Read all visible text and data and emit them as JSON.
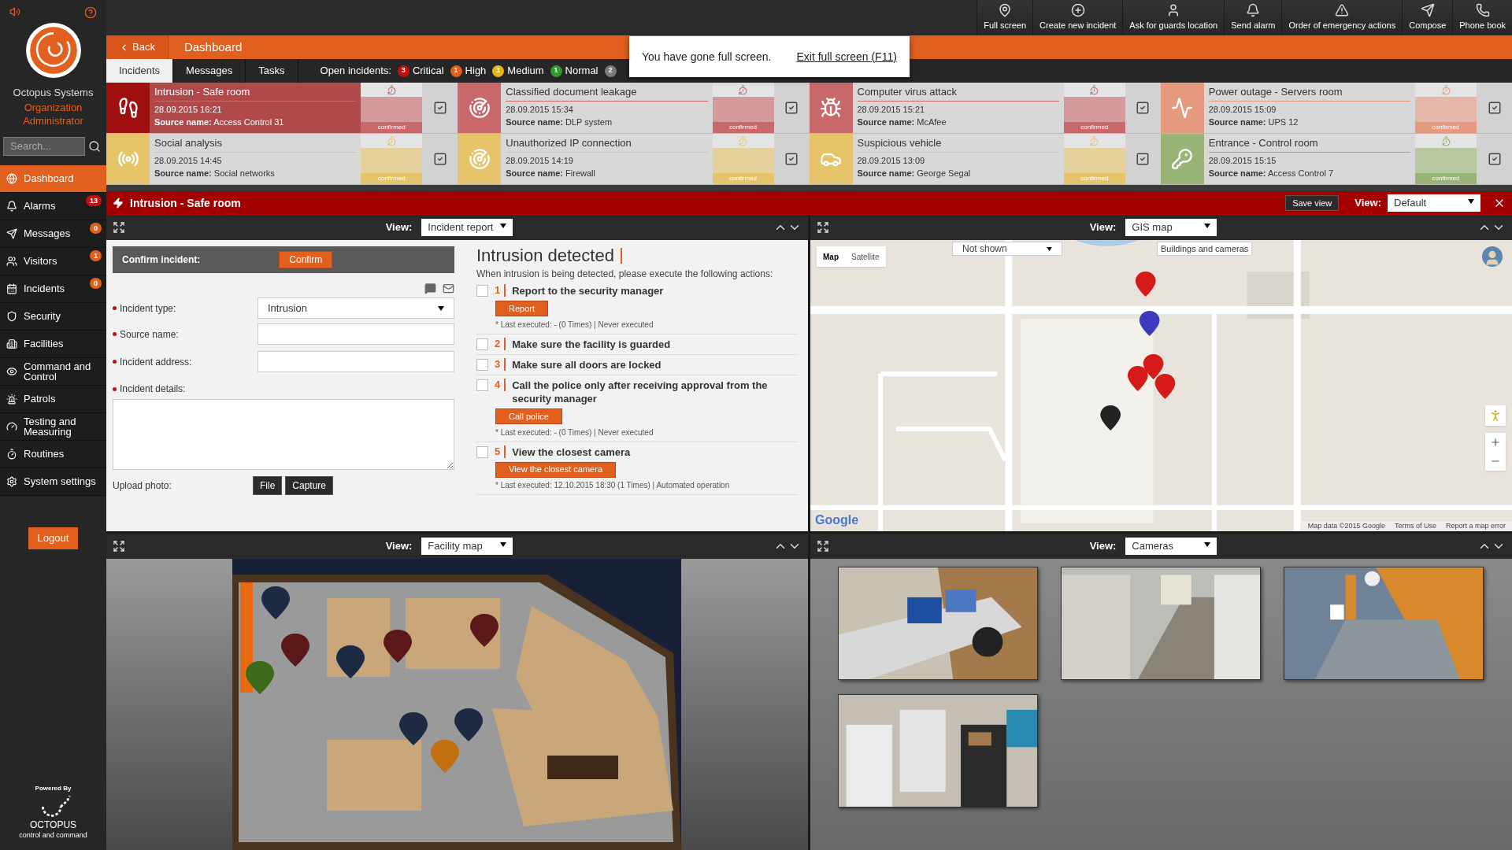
{
  "top_toolbar": [
    {
      "label": "Full screen"
    },
    {
      "label": "Create new incident"
    },
    {
      "label": "Ask for guards location"
    },
    {
      "label": "Send alarm"
    },
    {
      "label": "Order of emergency actions"
    },
    {
      "label": "Compose"
    },
    {
      "label": "Phone book"
    }
  ],
  "sidebar": {
    "org_name": "Octopus Systems",
    "role": "Organization Administrator",
    "search": {
      "placeholder": "Search..."
    },
    "items": [
      {
        "label": "Dashboard",
        "selected": true
      },
      {
        "label": "Alarms",
        "selected": false,
        "badge": "13",
        "color": "#c40f0f"
      },
      {
        "label": "Messages",
        "selected": false,
        "badge": "0",
        "color": "#e2601f"
      },
      {
        "label": "Visitors",
        "selected": false,
        "badge": "1",
        "color": "#e2601f"
      },
      {
        "label": "Incidents",
        "selected": false,
        "badge": "0",
        "color": "#e2601f"
      },
      {
        "label": "Security",
        "selected": false
      },
      {
        "label": "Facilities",
        "selected": false
      },
      {
        "label": "Command and Control",
        "selected": false
      },
      {
        "label": "Patrols",
        "selected": false
      },
      {
        "label": "Testing and Measuring",
        "selected": false
      },
      {
        "label": "Routines",
        "selected": false
      },
      {
        "label": "System settings",
        "selected": false
      }
    ],
    "logout": "Logout",
    "powered_by": "Powered By",
    "brand": "OCTOPUS",
    "brand_tagline": "control and command"
  },
  "header": {
    "back": "Back",
    "title": "Dashboard"
  },
  "tabs": [
    {
      "label": "Incidents",
      "selected": true
    },
    {
      "label": "Messages",
      "selected": false
    },
    {
      "label": "Tasks",
      "selected": false
    }
  ],
  "open_incidents": {
    "label": "Open incidents:",
    "levels": [
      {
        "count": "3",
        "label": "Critical",
        "color": "#c40f0f"
      },
      {
        "count": "1",
        "label": "High",
        "color": "#e2601f"
      },
      {
        "count": "1",
        "label": "Medium",
        "color": "#e8b51c"
      },
      {
        "count": "1",
        "label": "Normal",
        "color": "#2f9a2f"
      },
      {
        "count": "2",
        "color": "#7a7a7a"
      }
    ]
  },
  "fullscreen_notice": {
    "message": "You have gone full screen.",
    "link": "Exit full screen (F11)"
  },
  "incident_cards": [
    {
      "title": "Intrusion - Safe room",
      "date": "28.09.2015 16:21",
      "source_label": "Source name:",
      "source": "Access Control 31",
      "color": "#c8686b",
      "selected": true,
      "status": "confirmed"
    },
    {
      "title": "Classified document leakage",
      "date": "28.09.2015 15:34",
      "source_label": "Source name:",
      "source": "DLP system",
      "color": "#c8686b",
      "selected": false,
      "status": "confirmed"
    },
    {
      "title": "Computer virus attack",
      "date": "28.09.2015 15:21",
      "source_label": "Source name:",
      "source": "McAfee",
      "color": "#c8686b",
      "selected": false,
      "status": "confirmed"
    },
    {
      "title": "Power outage - Servers room",
      "date": "28.09.2015 15:09",
      "source_label": "Source name:",
      "source": "UPS 12",
      "color": "#e59a80",
      "selected": false,
      "status": "confirmed"
    },
    {
      "title": "Social analysis",
      "date": "28.09.2015 14:45",
      "source_label": "Source name:",
      "source": "Social networks",
      "color": "#e6c46a",
      "selected": false,
      "status": "confirmed"
    },
    {
      "title": "Unauthorized IP connection",
      "date": "28.09.2015 14:19",
      "source_label": "Source name:",
      "source": "Firewall",
      "color": "#e6c46a",
      "selected": false,
      "status": "confirmed"
    },
    {
      "title": "Suspicious vehicle",
      "date": "28.09.2015 13:09",
      "source_label": "Source name:",
      "source": "George Segal",
      "color": "#e6c46a",
      "selected": false,
      "status": "confirmed"
    },
    {
      "title": "Entrance - Control room",
      "date": "28.09.2015 15:15",
      "source_label": "Source name:",
      "source": "Access Control 7",
      "color": "#98b476",
      "selected": false,
      "status": "confirmed"
    }
  ],
  "incident_bar": {
    "title": "Intrusion - Safe room",
    "save_view": "Save view",
    "view_label": "View:",
    "view": "Default"
  },
  "report_panel": {
    "view_label": "View:",
    "view": "Incident report",
    "confirm_label": "Confirm incident:",
    "confirm_button": "Confirm",
    "fields": [
      {
        "label": "Incident type:",
        "kind": "select",
        "value": "Intrusion"
      },
      {
        "label": "Source name:",
        "kind": "text"
      },
      {
        "label": "Incident address:",
        "kind": "text"
      },
      {
        "label": "Incident details:",
        "kind": "textarea"
      }
    ],
    "upload_label": "Upload photo:",
    "upload_buttons": [
      "File",
      "Capture"
    ],
    "heading": "Intrusion detected",
    "intro": "When intrusion is being detected, please execute the following actions:",
    "actions": [
      {
        "number": "1",
        "text": "Report to the security manager",
        "checked": false,
        "button": "Report",
        "note": "* Last executed: - (0 Times) | Never executed"
      },
      {
        "number": "2",
        "text": "Make sure the facility is guarded",
        "checked": false
      },
      {
        "number": "3",
        "text": "Make sure all doors are locked",
        "checked": false
      },
      {
        "number": "4",
        "text": "Call the police only after receiving approval from the security manager",
        "checked": false,
        "button": "Call police",
        "note": "* Last executed: - (0 Times) | Never executed"
      },
      {
        "number": "5",
        "text": "View the closest camera",
        "checked": false,
        "button": "View the closest camera",
        "note": "* Last executed: 12.10.2015 18:30 (1 Times) | Automated operation"
      }
    ]
  },
  "gis_panel": {
    "view_label": "View:",
    "view": "GIS map",
    "map_types": [
      {
        "label": "Map",
        "selected": true
      },
      {
        "label": "Satellite",
        "selected": false
      }
    ],
    "layer_select": "Not shown",
    "layer_filter": "Buildings and cameras",
    "logo": "Google",
    "attribution": [
      "Map data ©2015 Google",
      "Terms of Use",
      "Report a map error"
    ]
  },
  "facility_panel": {
    "view_label": "View:",
    "view": "Facility map"
  },
  "cameras_panel": {
    "view_label": "View:",
    "view": "Cameras"
  }
}
